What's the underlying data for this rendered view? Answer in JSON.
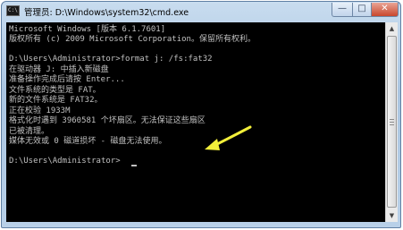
{
  "window": {
    "title": "管理员: D:\\Windows\\system32\\cmd.exe",
    "icon_text": "C:\\",
    "controls": {
      "minimize": "—",
      "maximize": "□",
      "close": "✕"
    }
  },
  "console": {
    "lines": [
      "Microsoft Windows [版本 6.1.7601]",
      "版权所有 (c) 2009 Microsoft Corporation。保留所有权利。",
      "",
      "D:\\Users\\Administrator>format j: /fs:fat32",
      "在驱动器 J: 中插入新磁盘",
      "准备操作完成后请按 Enter...",
      "文件系统的类型是 FAT。",
      "新的文件系统是 FAT32。",
      "正在校验 1933M",
      "格式化时遇到 3960581 个坏扇区。无法保证这些扇区",
      "已被清理。",
      "媒体无效或 0 磁道损坏 - 磁盘无法使用。",
      "",
      "D:\\Users\\Administrator>"
    ],
    "text_color": "#c0c0c0",
    "background": "#000000",
    "annotation_arrow_color": "#f2ef3a"
  },
  "scrollbar": {
    "up_arrow": "▲",
    "down_arrow": "▼"
  }
}
